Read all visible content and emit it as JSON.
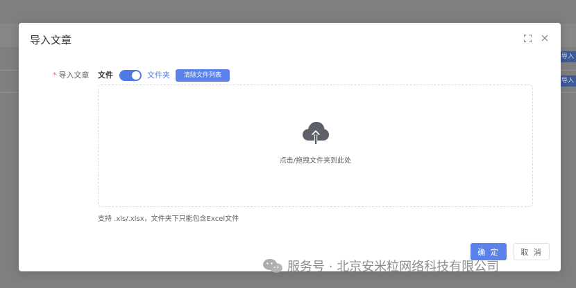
{
  "background": {
    "tags": [
      "导入",
      "导入"
    ]
  },
  "dialog": {
    "title": "导入文章",
    "form": {
      "label": "导入文章",
      "switch_off_label": "文件",
      "switch_on_label": "文件夹",
      "switch_on": true,
      "clear_button": "清除文件列表"
    },
    "dropzone": {
      "text": "点击/拖拽文件夹到此处"
    },
    "hint": "支持 .xls/.xlsx，文件夹下只能包含Excel文件",
    "footer": {
      "confirm": "确 定",
      "cancel": "取 消"
    }
  },
  "watermark": {
    "text": "服务号 · 北京安米粒网络科技有限公司"
  },
  "colors": {
    "primary": "#5a82ea",
    "required": "#f56c6c"
  }
}
